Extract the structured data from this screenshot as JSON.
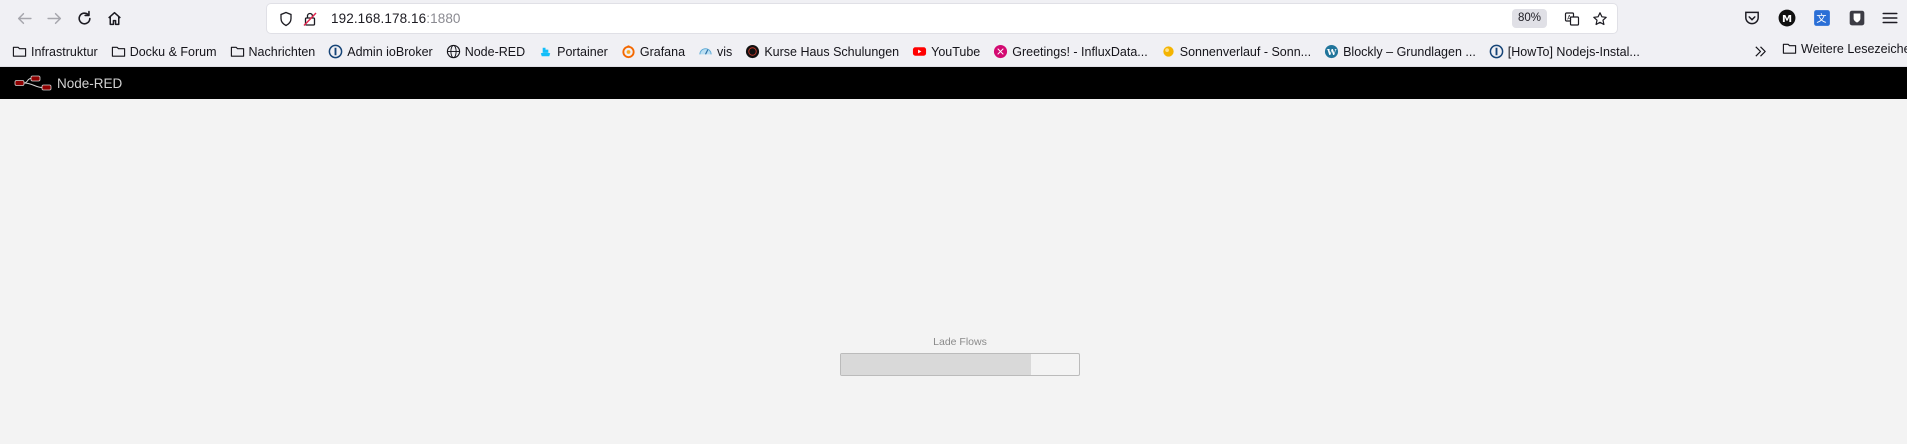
{
  "browser": {
    "url_host": "192.168.178.16",
    "url_port": ":1880",
    "zoom": "80%"
  },
  "bookmarks": [
    {
      "label": "Infrastruktur",
      "icon": "folder-icon"
    },
    {
      "label": "Docku & Forum",
      "icon": "folder-icon"
    },
    {
      "label": "Nachrichten",
      "icon": "folder-icon"
    },
    {
      "label": "Admin ioBroker",
      "icon": "iobroker-icon"
    },
    {
      "label": "Node-RED",
      "icon": "globe-icon"
    },
    {
      "label": "Portainer",
      "icon": "portainer-icon"
    },
    {
      "label": "Grafana",
      "icon": "grafana-icon"
    },
    {
      "label": "vis",
      "icon": "vis-icon"
    },
    {
      "label": "Kurse Haus Schulungen",
      "icon": "dark-circle-icon"
    },
    {
      "label": "YouTube",
      "icon": "youtube-icon"
    },
    {
      "label": "Greetings! - InfluxData...",
      "icon": "influxdb-icon"
    },
    {
      "label": "Sonnenverlauf - Sonn...",
      "icon": "sun-icon"
    },
    {
      "label": "Blockly – Grundlagen ...",
      "icon": "wordpress-icon"
    },
    {
      "label": "[HowTo] Nodejs-Instal...",
      "icon": "iobroker-icon"
    }
  ],
  "bookmarks_more": "Weitere Lesezeichen",
  "nodered": {
    "title": "Node-RED",
    "loading_label": "Lade Flows",
    "progress": 0.8
  },
  "colors": {
    "header_bg": "#000000",
    "workspace_bg": "#f3f3f3",
    "logo_accent": "#8f0000"
  }
}
